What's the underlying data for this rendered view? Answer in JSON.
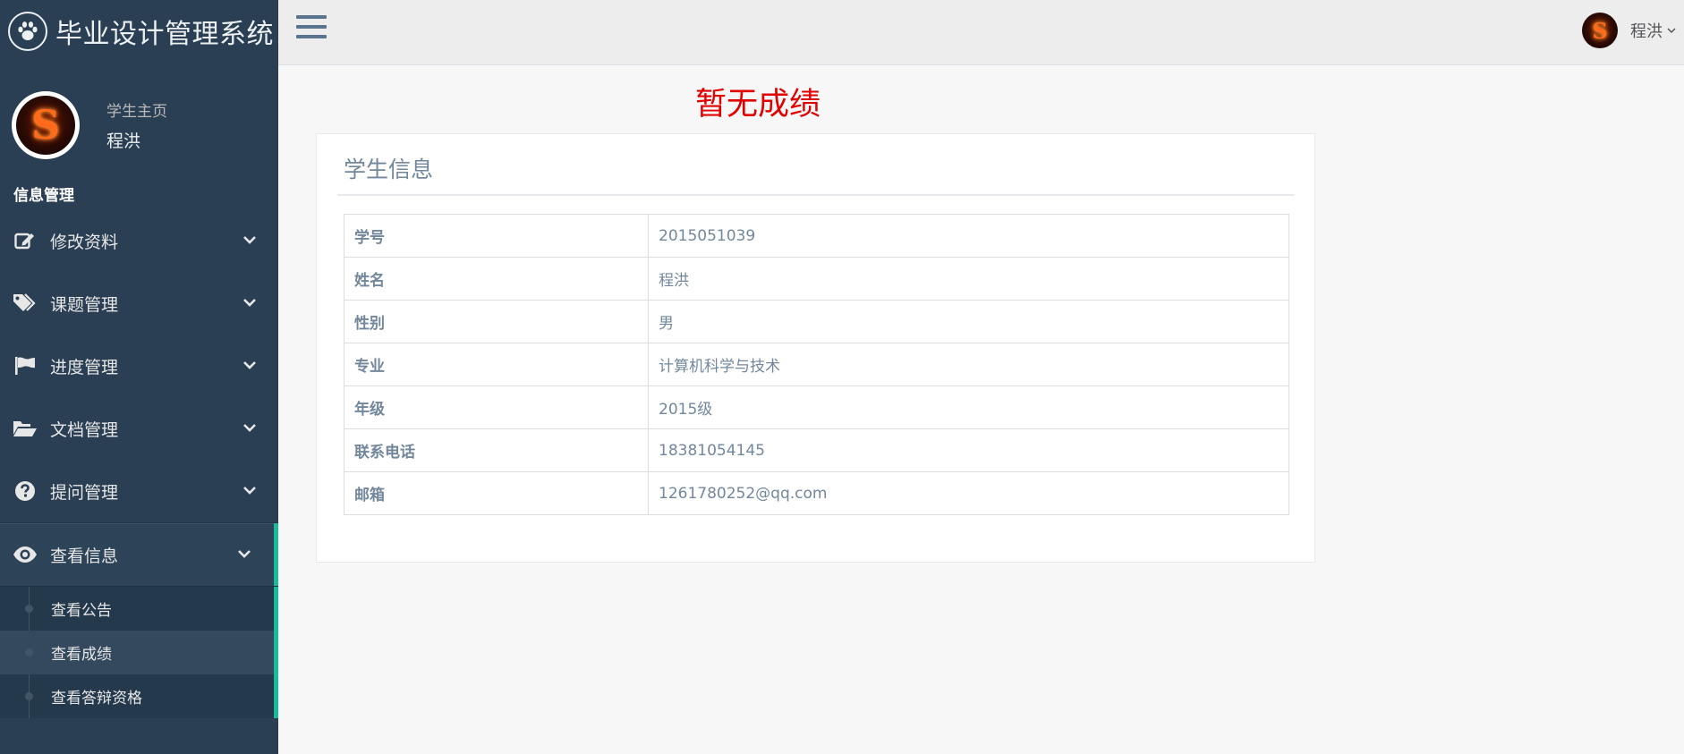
{
  "app": {
    "title": "毕业设计管理系统"
  },
  "profile": {
    "welcome": "学生主页",
    "name": "程洪"
  },
  "sidebar": {
    "section_title": "信息管理",
    "items": [
      {
        "label": "修改资料",
        "icon": "edit-icon"
      },
      {
        "label": "课题管理",
        "icon": "tags-icon"
      },
      {
        "label": "进度管理",
        "icon": "flag-icon"
      },
      {
        "label": "文档管理",
        "icon": "folder-open-icon"
      },
      {
        "label": "提问管理",
        "icon": "question-circle-icon"
      },
      {
        "label": "查看信息",
        "icon": "eye-icon",
        "expanded": true
      }
    ],
    "subitems": [
      {
        "label": "查看公告"
      },
      {
        "label": "查看成绩",
        "current": true
      },
      {
        "label": "查看答辩资格"
      }
    ]
  },
  "topnav": {
    "user_name": "程洪",
    "avatar_letter": "S"
  },
  "main": {
    "grade_notice": "暂无成绩",
    "panel_title": "学生信息",
    "rows": [
      {
        "label": "学号",
        "value": "2015051039"
      },
      {
        "label": "姓名",
        "value": "程洪"
      },
      {
        "label": "性别",
        "value": "男"
      },
      {
        "label": "专业",
        "value": "计算机科学与技术"
      },
      {
        "label": "年级",
        "value": "2015级"
      },
      {
        "label": "联系电话",
        "value": "18381054145"
      },
      {
        "label": "邮箱",
        "value": "1261780252@qq.com"
      }
    ]
  },
  "colors": {
    "sidebar_bg": "#2a3f54",
    "accent": "#1abb9c",
    "notice_red": "#e00000",
    "text_muted": "#73879c"
  }
}
